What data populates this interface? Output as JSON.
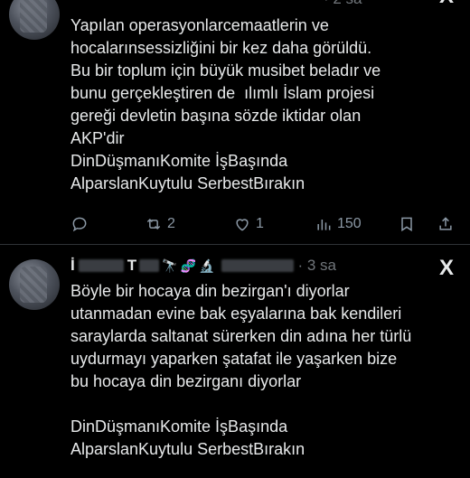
{
  "tweet1": {
    "time": "· 2 sa",
    "lines": [
      "Yapılan operasyonlarcemaatlerin ve",
      "hocalarınsessizliğini bir kez daha görüldü.",
      "Bu bir toplum için büyük musibet beladır ve",
      "bunu gerçekleştiren de  ılımlı İslam projesi",
      "gereği devletin başına sözde iktidar olan",
      "AKP'dir",
      "DinDüşmanıKomite İşBaşında",
      "AlparslanKuytulu SerbestBırakın"
    ],
    "actions": {
      "retweets": "2",
      "likes": "1",
      "views": "150"
    }
  },
  "tweet2": {
    "name_initial": "İ",
    "name_part": "T",
    "time": "· 3 sa",
    "emojis": [
      "🔭",
      "🧬",
      "🔬"
    ],
    "lines": [
      "Böyle bir hocaya din bezirgan'ı diyorlar",
      "utanmadan evine bak eşyalarına bak kendileri",
      "saraylarda saltanat sürerken din adına her türlü",
      "uydurmayı yaparken şatafat ile yaşarken bize",
      "bu hocaya din bezirganı diyorlar"
    ],
    "hashtags": [
      "DinDüşmanıKomite İşBaşında",
      "AlparslanKuytulu SerbestBırakın"
    ]
  },
  "logo": "X"
}
